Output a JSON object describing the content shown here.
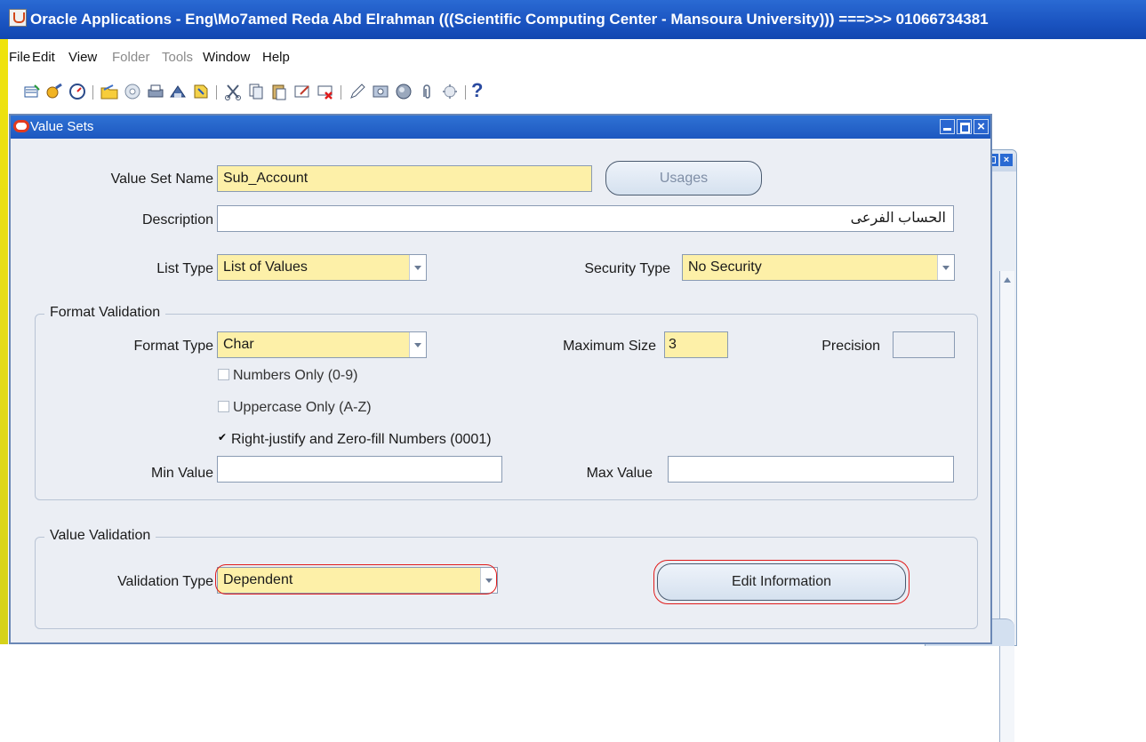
{
  "app": {
    "title": "Oracle Applications - Eng\\Mo7amed Reda Abd Elrahman (((Scientific Computing Center - Mansoura University))) ===>>> 01066734381"
  },
  "menu": {
    "items": [
      {
        "label": "File",
        "enabled": true
      },
      {
        "label": "Edit",
        "enabled": true
      },
      {
        "label": "View",
        "enabled": true
      },
      {
        "label": "Folder",
        "enabled": false
      },
      {
        "label": "Tools",
        "enabled": false
      },
      {
        "label": "Window",
        "enabled": true
      },
      {
        "label": "Help",
        "enabled": true
      }
    ]
  },
  "toolbar": {
    "help_glyph": "?",
    "icons": [
      "new-icon",
      "find-icon",
      "navigator-icon",
      "open-folder-icon",
      "save-icon",
      "print-icon",
      "close-form-icon",
      "zoom-icon",
      "cut-icon",
      "copy-icon",
      "paste-icon",
      "new-record-icon",
      "delete-record-icon",
      "edit-field-icon",
      "folder-tools-icon",
      "translations-icon",
      "attachments-icon",
      "folder-settings-icon",
      "help-icon"
    ]
  },
  "window": {
    "title": "Value Sets",
    "close_glyph": "×",
    "value_set_name": {
      "label": "Value Set Name",
      "value": "Sub_Account"
    },
    "usages_button": "Usages",
    "description": {
      "label": "Description",
      "value": "الحساب الفرعى"
    },
    "list_type": {
      "label": "List Type",
      "value": "List of Values"
    },
    "security_type": {
      "label": "Security Type",
      "value": "No Security"
    },
    "format_validation": {
      "title": "Format Validation",
      "format_type": {
        "label": "Format Type",
        "value": "Char"
      },
      "maximum_size": {
        "label": "Maximum Size",
        "value": "3"
      },
      "precision": {
        "label": "Precision",
        "value": ""
      },
      "numbers_only": {
        "label": "Numbers Only (0-9)",
        "checked": false
      },
      "uppercase_only": {
        "label": "Uppercase Only (A-Z)",
        "checked": false
      },
      "right_justify": {
        "label": "Right-justify and Zero-fill Numbers (0001)",
        "checked": true
      },
      "min_value": {
        "label": "Min Value",
        "value": ""
      },
      "max_value": {
        "label": "Max Value",
        "value": ""
      }
    },
    "value_validation": {
      "title": "Value Validation",
      "validation_type": {
        "label": "Validation Type",
        "value": "Dependent"
      },
      "edit_information_button": "Edit Information"
    }
  },
  "colors": {
    "titlebar": "#1a53c0",
    "required_field": "#fdf0a8",
    "form_background": "#ebeef4",
    "highlight_ring": "#e01b1b"
  }
}
